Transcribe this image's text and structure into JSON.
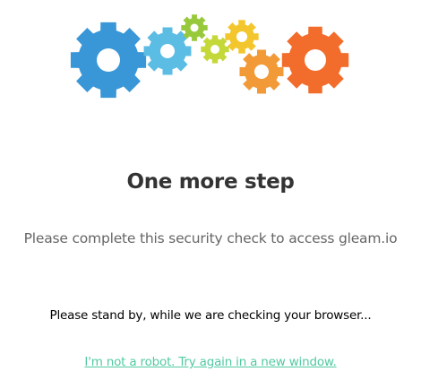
{
  "logo": {
    "gears": [
      {
        "name": "large-blue-gear-icon",
        "color": "#3a97d7"
      },
      {
        "name": "light-blue-gear-icon",
        "color": "#5bbce4"
      },
      {
        "name": "small-green-gear-icon",
        "color": "#98c93c"
      },
      {
        "name": "small-lime-gear-icon",
        "color": "#c5d83a"
      },
      {
        "name": "yellow-gear-icon",
        "color": "#f2c62c"
      },
      {
        "name": "orange-gear-icon",
        "color": "#f29a37"
      },
      {
        "name": "large-orange-gear-icon",
        "color": "#f26d2c"
      }
    ]
  },
  "content": {
    "title": "One more step",
    "subtitle": "Please complete this security check to access gleam.io",
    "standby_text": "Please stand by, while we are checking your browser...",
    "retry_link": "I'm not a robot. Try again in a new window."
  },
  "colors": {
    "title": "#333333",
    "subtitle": "#666666",
    "link": "#52c9a2"
  }
}
